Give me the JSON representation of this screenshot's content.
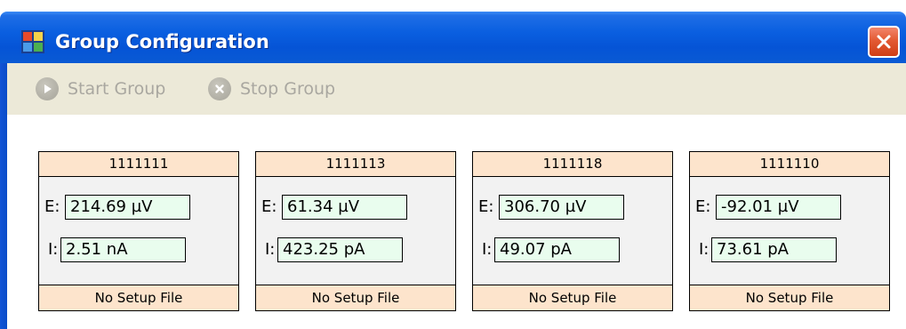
{
  "window": {
    "title": "Group Configuration",
    "icon": "app-grid-icon",
    "close_icon": "close-icon"
  },
  "toolbar": {
    "start_label": "Start Group",
    "start_icon": "play-icon",
    "stop_label": "Stop Group",
    "stop_icon": "stop-x-icon",
    "enabled": false
  },
  "groups": [
    {
      "id": "1111111",
      "e_label": "E:",
      "e_value": "214.69 µV",
      "i_label": "I:",
      "i_value": "2.51 nA",
      "setup": "No Setup File"
    },
    {
      "id": "1111113",
      "e_label": "E:",
      "e_value": "61.34 µV",
      "i_label": "I:",
      "i_value": "423.25 pA",
      "setup": "No Setup File"
    },
    {
      "id": "1111118",
      "e_label": "E:",
      "e_value": "306.70 µV",
      "i_label": "I:",
      "i_value": "49.07 pA",
      "setup": "No Setup File"
    },
    {
      "id": "1111110",
      "e_label": "E:",
      "e_value": "-92.01 µV",
      "i_label": "I:",
      "i_value": "73.61 pA",
      "setup": "No Setup File"
    }
  ],
  "colors": {
    "titlebar": "#0554d6",
    "toolbar_bg": "#ece9d8",
    "panel_header": "#fde4cc",
    "value_field": "#e9fdee",
    "disabled_text": "#a9a7a0",
    "close_button": "#e35a33"
  }
}
